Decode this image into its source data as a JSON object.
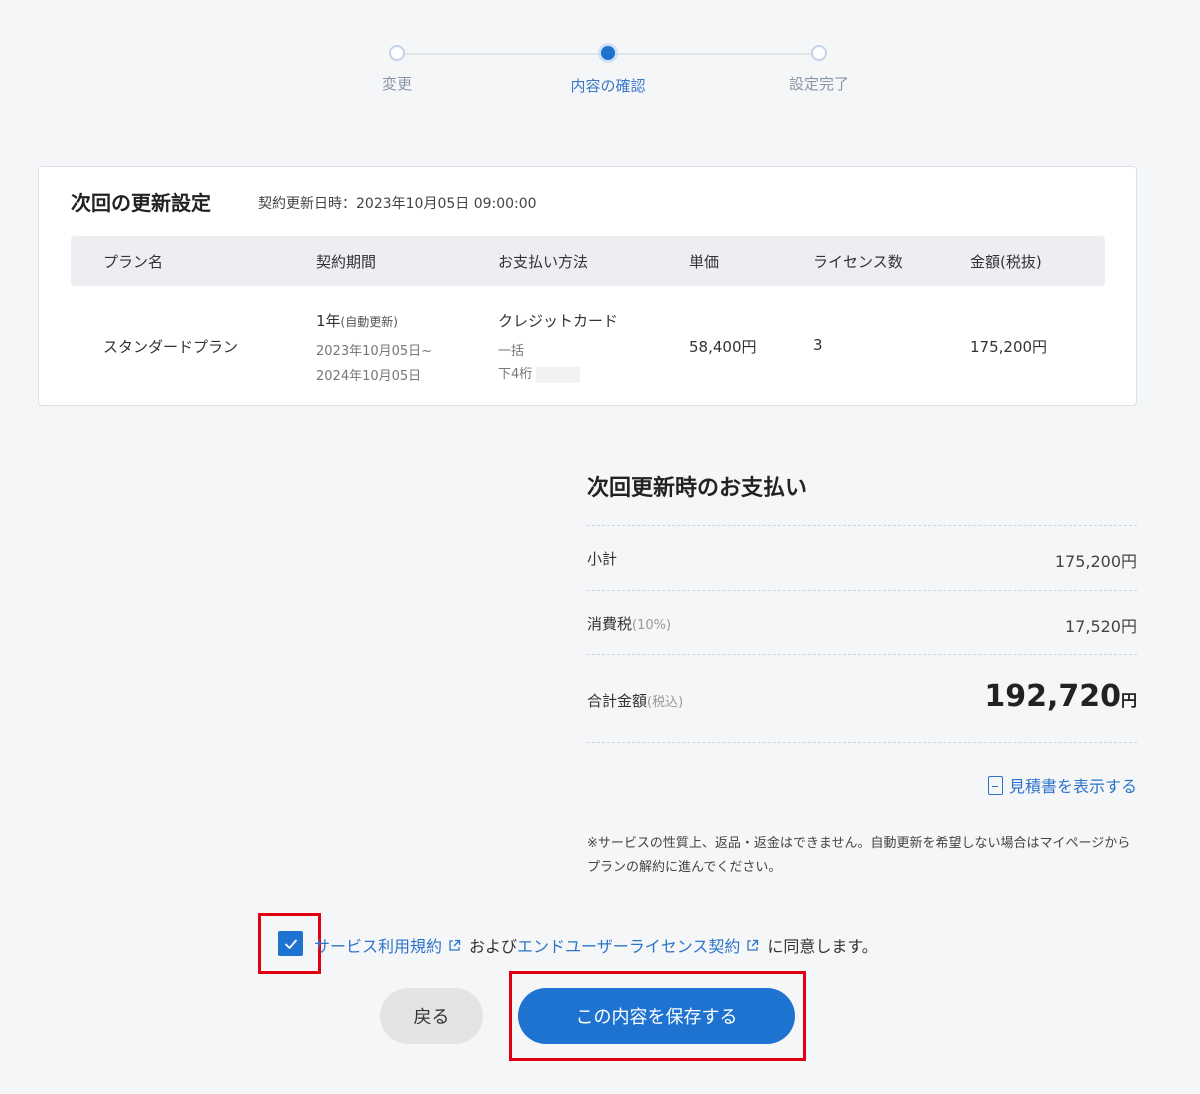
{
  "stepper": {
    "steps": [
      {
        "label": "変更"
      },
      {
        "label": "内容の確認"
      },
      {
        "label": "設定完了"
      }
    ]
  },
  "renewal": {
    "title": "次回の更新設定",
    "date_text": "契約更新日時：2023年10月05日 09:00:00",
    "columns": [
      "プラン名",
      "契約期間",
      "お支払い方法",
      "単価",
      "ライセンス数",
      "金額(税抜)"
    ],
    "row": {
      "plan": "スタンダードプラン",
      "period_main": "1年",
      "period_note": "(自動更新)",
      "period_start": "2023年10月05日~",
      "period_end": "2024年10月05日",
      "payment_method": "クレジットカード",
      "payment_type": "一括",
      "card_last4_label": "下4桁",
      "unit_price": "58,400円",
      "licenses": "3",
      "amount": "175,200円"
    }
  },
  "summary": {
    "title": "次回更新時のお支払い",
    "subtotal_label": "小計",
    "subtotal_value": "175,200円",
    "tax_label": "消費税",
    "tax_note": "(10%)",
    "tax_value": "17,520円",
    "total_label": "合計金額",
    "total_note": "(税込)",
    "total_value": "192,720",
    "total_unit": "円",
    "estimate_link": "見積書を表示する",
    "notice": "※サービスの性質上、返品・返金はできません。自動更新を希望しない場合はマイページからプランの解約に進んでください。"
  },
  "agreement": {
    "terms_link": "サービス利用規約",
    "and_text": "および",
    "eula_link": "エンドユーザーライセンス契約",
    "suffix": "に同意します。",
    "checked": true
  },
  "buttons": {
    "back": "戻る",
    "save": "この内容を保存する"
  },
  "colors": {
    "accent": "#1e72d0",
    "link": "#2d74c8",
    "highlight": "#e0000f"
  }
}
